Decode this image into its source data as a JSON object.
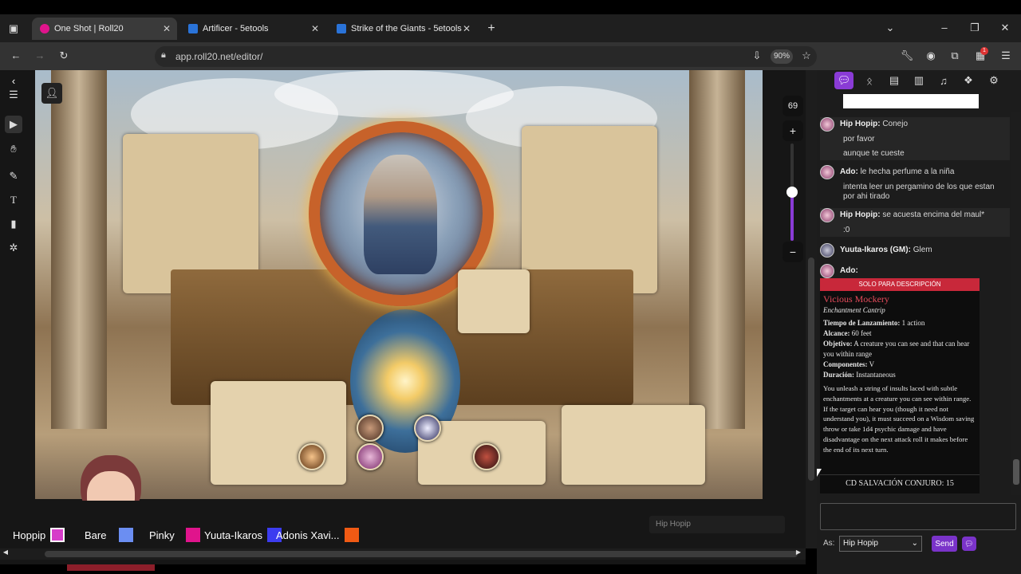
{
  "browser": {
    "tabs": [
      {
        "title": "One Shot | Roll20"
      },
      {
        "title": "Artificer - 5etools"
      },
      {
        "title": "Strike of the Giants - 5etools"
      }
    ],
    "url": "app.roll20.net/editor/",
    "zoom": "90%",
    "notif_count": "1"
  },
  "colors": {
    "accent": "#8a3bd6",
    "banner": "#c8283a",
    "tab_active": "#3a3a3a"
  },
  "icons": [
    "window-icon",
    "close-icon",
    "plus-icon",
    "chevron-down-icon",
    "minimize-icon",
    "restore-icon",
    "back-icon",
    "forward-icon",
    "reload-icon",
    "lock-icon",
    "install-icon",
    "star-icon",
    "wrench-icon",
    "profile-icon",
    "extensions-icon",
    "menu-icon"
  ],
  "canvas": {
    "zoom_value": "69",
    "zoom_level": 0.5
  },
  "players": [
    {
      "name": "Hoppip",
      "color": "#d63cc9"
    },
    {
      "name": "Bare",
      "color": "#6b8ef2"
    },
    {
      "name": "Pinky",
      "color": "#e0148c"
    },
    {
      "name": "Yuuta-Ikaros",
      "color": "#3c3cf0"
    },
    {
      "name": "Adonis Xavi...",
      "color": "#f05a14"
    }
  ],
  "typing_indicator": "Hip Hopip",
  "chat": {
    "messages": [
      {
        "who": "Hip Hopip:",
        "text": "Conejo",
        "extra": [
          "por favor",
          "aunque te cueste"
        ]
      },
      {
        "who": "Ado:",
        "text": "le hecha perfume a la niña",
        "extra": [
          "intenta leer un pergamino de los que estan",
          "por ahi tirado"
        ]
      },
      {
        "who": "Hip Hopip:",
        "text": "se acuesta encima del maul*",
        "extra": [
          ":0"
        ]
      },
      {
        "who": "Yuuta-Ikaros (GM):",
        "text": "Glem",
        "extra": []
      },
      {
        "who": "Ado:",
        "text": "",
        "extra": []
      }
    ],
    "card": {
      "banner": "SOLO PARA DESCRIPCIÓN",
      "spell_name": "Vicious Mockery",
      "school": "Enchantment Cantrip",
      "casting_time_label": "Tiempo de Lanzamiento:",
      "casting_time": "1 action",
      "range_label": "Alcance:",
      "range": "60 feet",
      "target_label": "Objetivo:",
      "target": "A creature you can see and that can hear you within range",
      "components_label": "Componentes:",
      "components": "V",
      "duration_label": "Duración:",
      "duration": "Instantaneous",
      "description": "You unleash a string of insults laced with subtle enchantments at a creature you can see within range. If the target can hear you (though it need not understand you), it must succeed on a Wisdom saving throw or take 1d4 psychic damage and have disadvantage on the next attack roll it makes before the end of its next turn.",
      "save_dc": "CD SALVACIÓN CONJURO: 15"
    },
    "as_label": "As:",
    "as_value": "Hip Hopip",
    "send_label": "Send"
  }
}
